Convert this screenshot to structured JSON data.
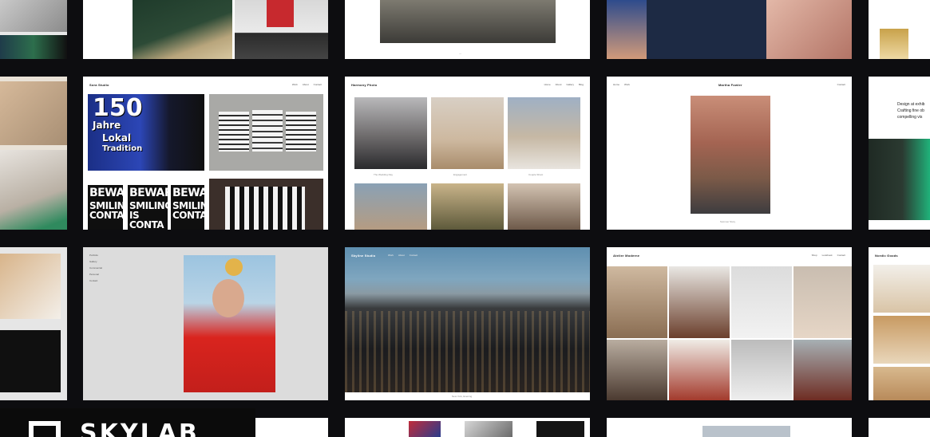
{
  "tiles": {
    "portfolio_a": {
      "brand": "Sora Studio",
      "links": [
        "Work",
        "About",
        "Contact"
      ]
    },
    "wedding": {
      "brand": "Harmony Photo",
      "links": [
        "Home",
        "About",
        "Gallery",
        "Blog"
      ],
      "captions": [
        "The Wedding Day",
        "Engagement",
        "Couple Shoot"
      ]
    },
    "model": {
      "links_left": [
        "Home",
        "Work"
      ],
      "brand": "Martha Fowler",
      "links_right": [
        "Contact"
      ],
      "caption": "Summer Story"
    },
    "cityscape": {
      "brand": "Skyline Studio",
      "links": [
        "Work",
        "About",
        "Contact"
      ],
      "caption": "New York, Evening"
    },
    "fashion": {
      "brand": "Atelier Moderne",
      "links": [
        "Shop",
        "Lookbook",
        "Contact"
      ]
    },
    "sidebar_portfolio": {
      "menu": [
        "Portfolio",
        "Gallery",
        "Commercial",
        "Personal",
        "Contact"
      ]
    },
    "right_edge": {
      "lines": [
        "Design at exhib",
        "Crafting fine ob",
        "compelling vis"
      ]
    },
    "products": {
      "brand": "Nordic Goods"
    }
  },
  "posters": {
    "beware": [
      {
        "l1": "BEWARE:",
        "l2": "SMILING",
        "l3": "CONTA-"
      },
      {
        "l1": "BEWARE:",
        "l2": "SMILING",
        "l3": "IS CONTA"
      },
      {
        "l1": "BEWARE:",
        "l2": "SMILING",
        "l3": "CONTA"
      }
    ],
    "anniversary": {
      "number": "150",
      "line1": "Jahre",
      "line2": "Lokal",
      "line3": "Tradition"
    }
  },
  "skylab": {
    "wordmark": "SKYLAB"
  },
  "colors": {
    "background": "#0d0d10",
    "card": "#ffffff",
    "accent_red": "#d9241e"
  }
}
